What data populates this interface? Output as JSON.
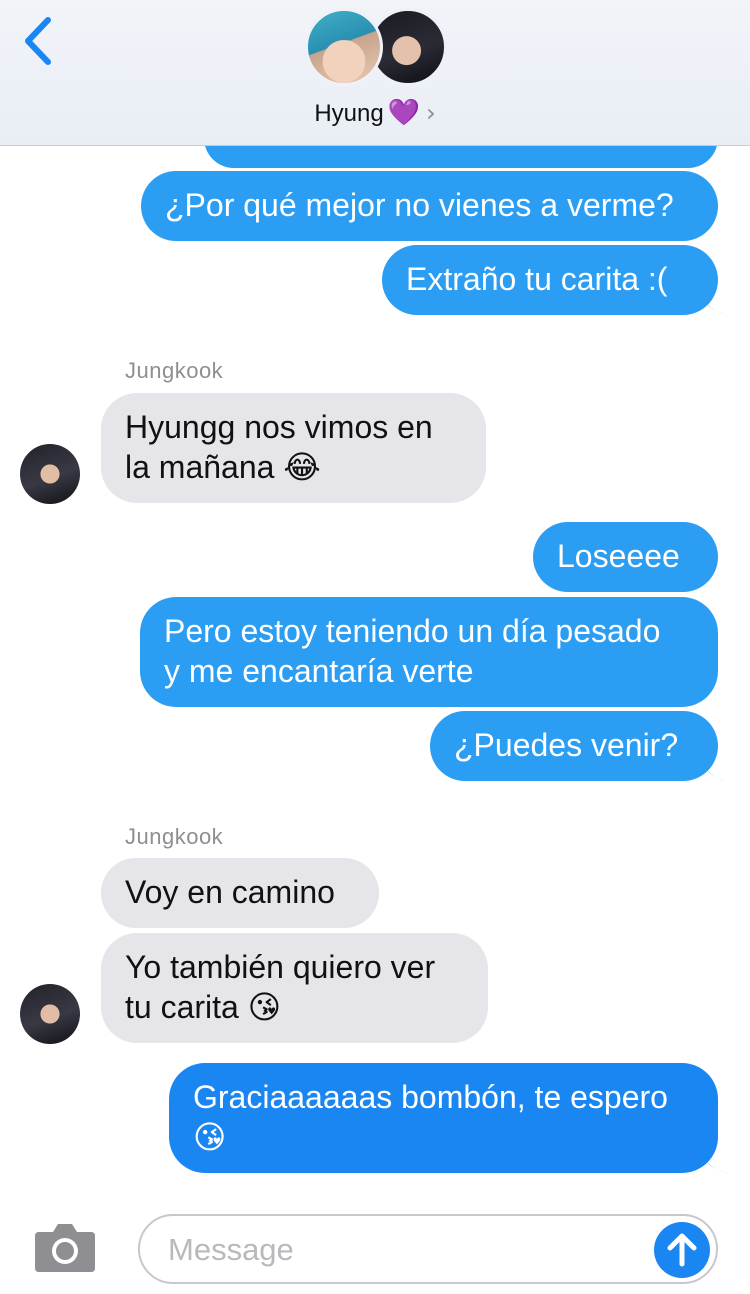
{
  "header": {
    "contact_name": "Hyung",
    "heart": "💜",
    "chevron": "›",
    "back_icon": "chevron-left-icon"
  },
  "messages": [
    {
      "from": "me",
      "text": "¿Por qué mejor no vienes a verme?"
    },
    {
      "from": "me",
      "text": "Extraño tu carita :("
    },
    {
      "from": "them",
      "sender": "Jungkook",
      "text_line1": "Hyungg nos vimos en",
      "text_line2": "la mañana 😂"
    },
    {
      "from": "me",
      "text": "Loseeee"
    },
    {
      "from": "me",
      "text_line1": "Pero estoy teniendo un día pesado",
      "text_line2": "y me encantaría verte"
    },
    {
      "from": "me",
      "text": "¿Puedes venir?"
    },
    {
      "from": "them",
      "sender": "Jungkook",
      "text": "Voy en camino"
    },
    {
      "from": "them",
      "text_line1": "Yo también quiero ver",
      "text_line2": "tu carita 😘"
    },
    {
      "from": "me",
      "text_line1": "Graciaaaaaas bombón, te espero",
      "text_line2": "😘"
    }
  ],
  "composer": {
    "placeholder": "Message",
    "camera_icon": "camera-icon",
    "send_icon": "arrow-up-icon"
  },
  "colors": {
    "outgoing": "#2b9ef4",
    "outgoing_last": "#1a86f2",
    "incoming": "#e5e5ea",
    "accent": "#1a86f2"
  }
}
